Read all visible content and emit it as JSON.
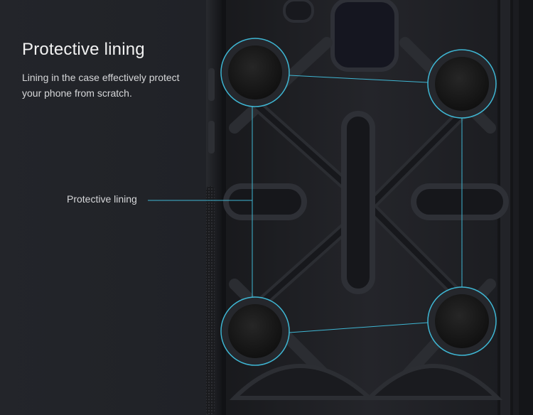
{
  "heading": {
    "title": "Protective lining",
    "description": "Lining in the case effectively protect your phone from scratch."
  },
  "callout": {
    "label": "Protective lining"
  },
  "colors": {
    "background": "#202226",
    "case": "#1e1f23",
    "lining_pad": "#151515",
    "accent_line": "#3fb6d3",
    "text_primary": "#f2f2f2",
    "text_secondary": "#d6d7d9"
  }
}
